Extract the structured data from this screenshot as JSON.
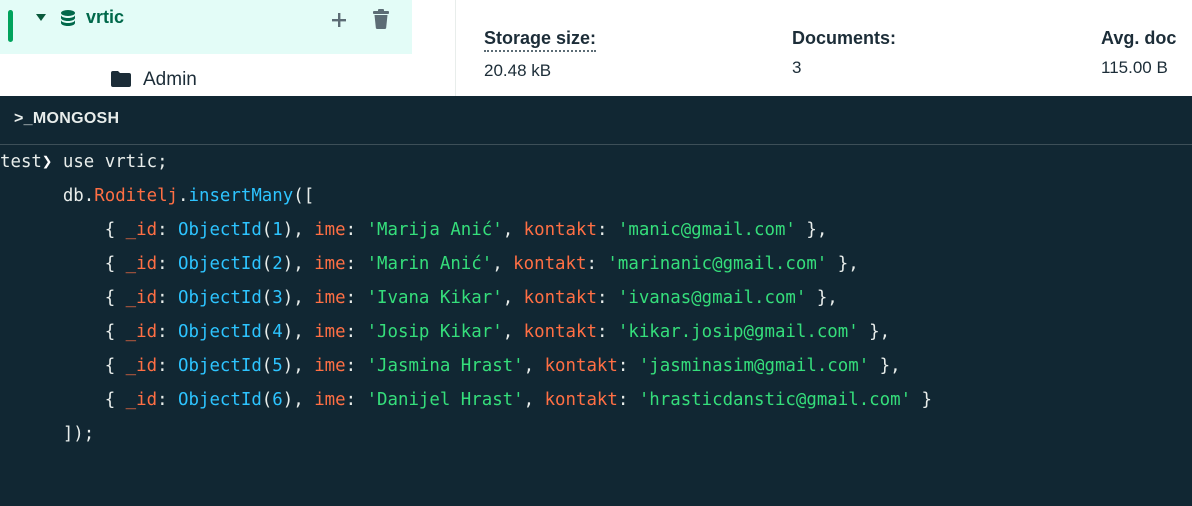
{
  "sidebar": {
    "database": {
      "name": "vrtic",
      "icon": "database-icon",
      "accent_color": "#00a35c"
    },
    "collection": {
      "name": "Admin",
      "icon": "folder-icon"
    }
  },
  "stats": [
    {
      "label": "Storage size:",
      "value": "20.48 kB"
    },
    {
      "label": "Documents:",
      "value": "3"
    },
    {
      "label": "Avg. doc",
      "value": "115.00 B"
    }
  ],
  "shell": {
    "title": ">_MONGOSH",
    "prompt": "test",
    "command": "use vrtic;",
    "db_call": {
      "db": "db",
      "collection": "Roditelj",
      "method": "insertMany",
      "open": "([",
      "close": "]);"
    },
    "keys": {
      "id": "_id",
      "name": "ime",
      "contact": "kontakt"
    },
    "constructor": "ObjectId",
    "rows": [
      {
        "id": "1",
        "ime": "'Marija Anić'",
        "kontakt": "'manic@gmail.com'",
        "end": " },"
      },
      {
        "id": "2",
        "ime": "'Marin Anić'",
        "kontakt": "'marinanic@gmail.com'",
        "end": " },"
      },
      {
        "id": "3",
        "ime": "'Ivana Kikar'",
        "kontakt": "'ivanas@gmail.com'",
        "end": " },"
      },
      {
        "id": "4",
        "ime": "'Josip Kikar'",
        "kontakt": "'kikar.josip@gmail.com'",
        "end": " },"
      },
      {
        "id": "5",
        "ime": "'Jasmina Hrast'",
        "kontakt": "'jasminasim@gmail.com'",
        "end": " },"
      },
      {
        "id": "6",
        "ime": "'Danijel Hrast'",
        "kontakt": "'hrasticdanstic@gmail.com'",
        "end": " }"
      }
    ]
  },
  "colors": {
    "shell_bg": "#112733",
    "string": "#35de7b",
    "identifier": "#ff6f44",
    "type": "#2dc4ff"
  }
}
